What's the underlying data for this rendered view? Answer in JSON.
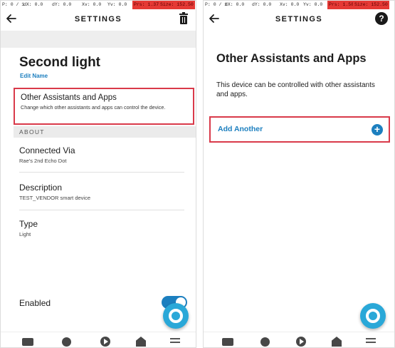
{
  "left_screen": {
    "status_bar": {
      "pointer": "P: 0 / 1",
      "dx": "dX: 0.0",
      "dy": "dY: 0.0",
      "xv": "Xv: 0.0",
      "yv": "Yv: 0.0",
      "prs": "Prs: 1.37",
      "size": "Size: 152.50"
    },
    "header": {
      "title": "SETTINGS",
      "back_icon": "arrow-left",
      "action_icon": "trash"
    },
    "device": {
      "name": "Second light",
      "edit_label": "Edit Name"
    },
    "other_assistants": {
      "title": "Other Assistants and Apps",
      "description": "Change which other assistants and apps can control the device."
    },
    "about_header": "ABOUT",
    "connected_via": {
      "title": "Connected Via",
      "value": "Rae's 2nd Echo Dot"
    },
    "description": {
      "title": "Description",
      "value": "TEST_VENDOR smart device"
    },
    "type": {
      "title": "Type",
      "value": "Light"
    },
    "enabled": {
      "label": "Enabled",
      "on": true
    }
  },
  "right_screen": {
    "status_bar": {
      "pointer": "P: 0 / 1",
      "dx": "dX: 0.0",
      "dy": "dY: 0.0",
      "xv": "Xv: 0.0",
      "yv": "Yv: 0.0",
      "prs": "Prs: 1.58",
      "size": "Size: 152.50"
    },
    "header": {
      "title": "SETTINGS",
      "back_icon": "arrow-left",
      "action_icon": "help"
    },
    "page_title": "Other Assistants and Apps",
    "description": "This device can be controlled with other assistants and apps.",
    "add_another": {
      "label": "Add Another",
      "icon": "plus-circle"
    }
  },
  "bottom_nav": [
    "home-icon",
    "chat-icon",
    "play-icon",
    "devices-icon",
    "more-icon"
  ],
  "help_glyph": "?",
  "plus_glyph": "+",
  "colors": {
    "accent": "#1c7fbf",
    "highlight_border": "#d93a4a",
    "alexa": "#2aa8d8"
  }
}
